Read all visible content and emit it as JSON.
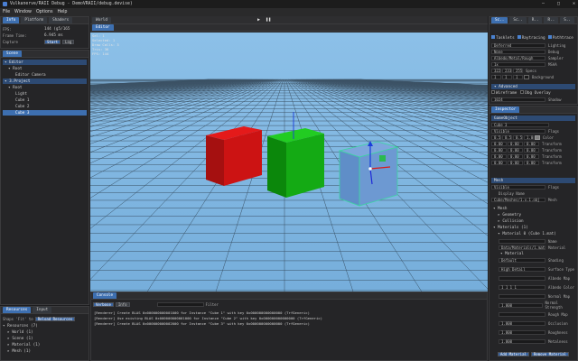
{
  "window": {
    "title": "Vulkanerve/RAII Debug - DemoVRAII/debug.devise)",
    "min": "—",
    "max": "□",
    "close": "✕"
  },
  "menu": [
    "File",
    "Window",
    "Options",
    "Help"
  ],
  "stats": {
    "tabs": [
      "Info",
      "Platform",
      "Shaders"
    ],
    "rows": [
      {
        "k": "FPS:",
        "v": "144 (g5/165"
      },
      {
        "k": "Frame Time:",
        "v": "6.945 ms"
      },
      {
        "k": "Capture",
        "v": "Start"
      }
    ],
    "extra_btn": "Log"
  },
  "scene": {
    "tab": "Scene",
    "items": [
      {
        "label": "▾ Editor",
        "indent": 0,
        "hdr": true
      },
      {
        "label": "▾ Root",
        "indent": 1
      },
      {
        "label": "Editor Camera",
        "indent": 3
      },
      {
        "label": "▾ 3.Project",
        "indent": 0,
        "hdr": true
      },
      {
        "label": "▾ Root",
        "indent": 1
      },
      {
        "label": "Light",
        "indent": 3
      },
      {
        "label": "Cube 1",
        "indent": 3
      },
      {
        "label": "Cube 2",
        "indent": 3
      },
      {
        "label": "Cube 3",
        "indent": 3,
        "sel": true
      }
    ]
  },
  "resources": {
    "tabs": [
      "Resources",
      "Input"
    ],
    "filter_label": "Shaps 'Fit' to",
    "filter_btn": "Reload Resources",
    "items": [
      "▾ Resources (7)",
      "  ▸ World (1)",
      "  ▸ Scene (1)",
      "  ▸ Material (1)",
      "  ▸ Mesh (1)"
    ]
  },
  "viewport": {
    "toolbar_tab": "World",
    "tab": "Editor",
    "overlay": [
      "Sel: 1",
      "Selected: 1",
      "Draw Calls: 3",
      "Tris: 36",
      "FPS: 144"
    ],
    "colors": {
      "sky": "#7fb3dd",
      "grid": "#1f2b38",
      "red": "#c81414",
      "green": "#11aa11",
      "blue": "#6c9bd4"
    }
  },
  "console": {
    "tab": "Console",
    "filters": [
      "Verbose",
      "Info"
    ],
    "filter_label": "Filter",
    "lines": [
      "[Renderer] Create BLAS 0x000000000001000 for Instance \"Cube 1\" with key 0x000000000000000 (TrfGeneric)",
      "[Renderer] Use existing BLAS 0x000000000001000 for Instance \"Cube 2\" with key 0x000000000000000 (TrfGeneric)",
      "[Renderer] Create BLAS 0x000000000002000 for Instance \"Cube 3\" with key 0x000000000000000 (TrfGeneric)"
    ]
  },
  "settings": {
    "tabs": [
      "Sc..",
      "Sc..",
      "R..",
      "R..",
      "S.."
    ],
    "checks": [
      {
        "label": "Tasklets",
        "on": true
      },
      {
        "label": "Raytracing",
        "on": true
      },
      {
        "label": "Pathtrace",
        "on": true
      }
    ],
    "rows": [
      {
        "v": "Deferred",
        "k": "Lighting"
      },
      {
        "v": "None",
        "k": "Debug"
      },
      {
        "v": "Albedo/Metal/Rough",
        "k": "Sampler"
      },
      {
        "v": "1x",
        "k": "MSAA"
      }
    ],
    "advanced": "▾ Advanced",
    "adv_checks": [
      "Wireframe",
      "Dbg Overlay"
    ],
    "shadow": {
      "v": "1024",
      "k": "Shadow"
    },
    "spec_vals": [
      "322",
      "233",
      "255"
    ],
    "spec_label": "Specs",
    "bg_vals": [
      "1",
      "1",
      "1"
    ],
    "bg_label": "Background"
  },
  "inspector": {
    "tab": "Inspector",
    "object": "GameObject",
    "name": "Cube 3",
    "flags_v": "Visible",
    "flags": "Flags",
    "color_vals": [
      "0.5",
      "0.5",
      "0.5",
      "1.0"
    ],
    "color_label": "Color",
    "transforms": [
      [
        "0.00",
        "0.00",
        "0.00"
      ],
      [
        "0.00",
        "0.00",
        "0.00"
      ],
      [
        "0.00",
        "0.00",
        "0.00"
      ],
      [
        "0.00",
        "0.00",
        "0.00"
      ]
    ],
    "transform_label": "Transform",
    "mesh_header": "Mesh",
    "mesh_flags_v": "Visible",
    "mesh_flags": "Flags",
    "display_name": "Display Name",
    "mesh_path": "Cube/Meshes/1.x.1.obj",
    "mesh_label": "Mesh",
    "tree": [
      "▾ Mesh",
      "  ▸ Geometry",
      "  ▸ Collision",
      "▾ Materials (1)",
      "  ▾ Material 0 (Cube 1.mat)"
    ],
    "mat_name": "Name",
    "mat_path": "Data/Materials/1.mat",
    "mat_label": "Material",
    "submat": "▾ Material",
    "mat_rows": [
      {
        "v": "Default",
        "k": "Shading"
      },
      {
        "v": "High Detail",
        "k": "Surface Type"
      },
      {
        "v": "",
        "k": "Albedo Map"
      },
      {
        "v": "1 1 1 1",
        "k": "Albedo Color"
      },
      {
        "v": "",
        "k": "Normal Map"
      },
      {
        "v": "1.000",
        "k": "Normal Strength"
      },
      {
        "v": "",
        "k": "Rough Map"
      },
      {
        "v": "1.000",
        "k": "Occlusion"
      },
      {
        "v": "1.000",
        "k": "Roughness"
      },
      {
        "v": "1.000",
        "k": "Metalness"
      }
    ],
    "footer_btns": [
      "Add Material",
      "Remove Material"
    ]
  }
}
